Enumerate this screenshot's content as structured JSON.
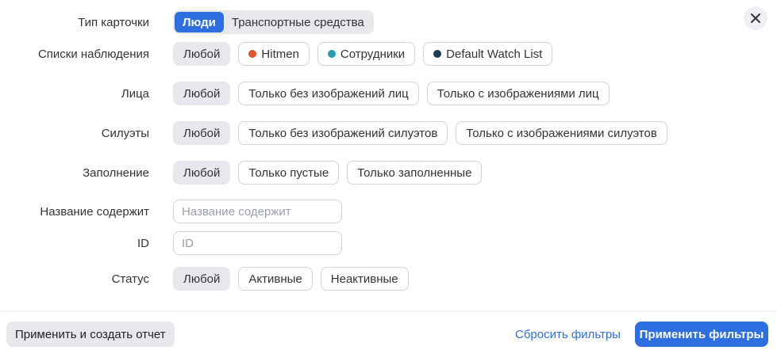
{
  "card_type": {
    "label": "Тип карточки",
    "options": [
      {
        "label": "Люди",
        "active": true
      },
      {
        "label": "Транспортные средства",
        "active": false
      }
    ]
  },
  "watch_lists": {
    "label": "Списки наблюдения",
    "any": "Любой",
    "items": [
      {
        "label": "Hitmen",
        "color": "#e4572e"
      },
      {
        "label": "Сотрудники",
        "color": "#2a9bb5"
      },
      {
        "label": "Default Watch List",
        "color": "#1f3a5a"
      }
    ]
  },
  "faces": {
    "label": "Лица",
    "options": [
      "Любой",
      "Только без изображений лиц",
      "Только с изображениями лиц"
    ]
  },
  "silhouettes": {
    "label": "Силуэты",
    "options": [
      "Любой",
      "Только без изображений силуэтов",
      "Только с изображениями силуэтов"
    ]
  },
  "filling": {
    "label": "Заполнение",
    "options": [
      "Любой",
      "Только пустые",
      "Только заполненные"
    ]
  },
  "name_contains": {
    "label": "Название содержит",
    "placeholder": "Название содержит"
  },
  "id_field": {
    "label": "ID",
    "placeholder": "ID"
  },
  "status": {
    "label": "Статус",
    "options": [
      "Любой",
      "Активные",
      "Неактивные"
    ]
  },
  "footer": {
    "apply_report": "Применить и создать отчет",
    "reset": "Сбросить фильтры",
    "apply": "Применить фильтры"
  },
  "colors": {
    "accent": "#2d6fe0",
    "chip_selected_bg": "#e6e8ec"
  }
}
